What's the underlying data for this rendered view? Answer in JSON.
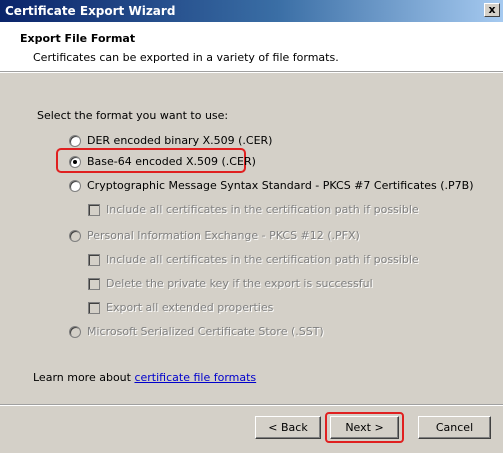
{
  "window": {
    "title": "Certificate Export Wizard",
    "close_glyph": "x"
  },
  "header": {
    "title": "Export File Format",
    "subtitle": "Certificates can be exported in a variety of file formats."
  },
  "body": {
    "prompt": "Select the format you want to use:",
    "options": {
      "der": {
        "label": "DER encoded binary X.509 (.CER)",
        "selected": false,
        "enabled": true
      },
      "base64": {
        "label": "Base-64 encoded X.509 (.CER)",
        "selected": true,
        "enabled": true
      },
      "pkcs7": {
        "label": "Cryptographic Message Syntax Standard - PKCS #7 Certificates (.P7B)",
        "selected": false,
        "enabled": true
      },
      "pkcs7_include_all": {
        "label": "Include all certificates in the certification path if possible",
        "checked": false,
        "enabled": false
      },
      "pfx": {
        "label": "Personal Information Exchange - PKCS #12 (.PFX)",
        "selected": false,
        "enabled": false
      },
      "pfx_include_all": {
        "label": "Include all certificates in the certification path if possible",
        "checked": false,
        "enabled": false
      },
      "pfx_delete_key": {
        "label": "Delete the private key if the export is successful",
        "checked": false,
        "enabled": false
      },
      "pfx_export_props": {
        "label": "Export all extended properties",
        "checked": false,
        "enabled": false
      },
      "sst": {
        "label": "Microsoft Serialized Certificate Store (.SST)",
        "selected": false,
        "enabled": false
      }
    },
    "learn_more_prefix": "Learn more about ",
    "learn_more_link": "certificate file formats"
  },
  "buttons": {
    "back": "< Back",
    "next": "Next >",
    "cancel": "Cancel"
  },
  "colors": {
    "highlight": "#e02020",
    "dialog": "#d4d0c8"
  }
}
